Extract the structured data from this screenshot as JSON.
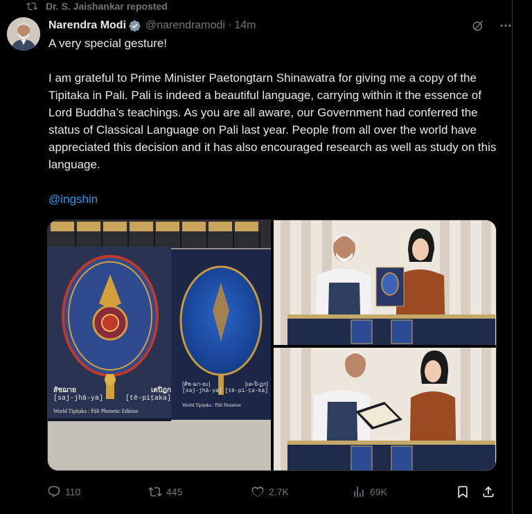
{
  "repost_bar": {
    "text": "Dr. S. Jaishankar reposted"
  },
  "author": {
    "name": "Narendra Modi",
    "handle": "@narendramodi",
    "separator": "·",
    "time": "14m"
  },
  "post": {
    "line1": "A very special gesture!",
    "paragraph": "I am grateful to Prime Minister Paetongtarn Shinawatra for giving me a copy of the Tipitaka in Pali. Pali is indeed a beautiful language, carrying within it the essence of Lord Buddha’s teachings. As you are all aware, our Government had conferred the status of Classical Language on Pali last year. People from all over the world have appreciated this decision and it has also encouraged research as well as study on this language.",
    "mention": "@ingshin"
  },
  "book_texts": {
    "left_thai": "สัชฌาย",
    "left_roman": "[saj-jhā-ya]",
    "left_thai2": "เตปิฎก",
    "left_roman2": "[tē-piṭaka]",
    "left_footer": "World Tipiṭaka : Pāli Phonetic Edition",
    "right_thai": "[สัช-ฌา-ยะ]",
    "right_roman": "[saj-jhā-ya]",
    "right_thai2": "[เต-ปิ-ฏก]",
    "right_roman2": "[tē-pi-ṭa-ka]",
    "right_footer": "World Tipiṭaka : Pāli Notation"
  },
  "actions": {
    "replies": "110",
    "reposts": "445",
    "likes": "2.7K",
    "views": "69K"
  },
  "colors": {
    "background": "#000000",
    "text": "#e7e9ea",
    "muted": "#71767b",
    "accent": "#1d9bf0",
    "border": "#2f3336"
  },
  "icons": [
    "repost-icon",
    "verified-badge-icon",
    "grok-icon",
    "more-icon",
    "reply-icon",
    "like-icon",
    "views-icon",
    "bookmark-icon",
    "share-icon"
  ]
}
